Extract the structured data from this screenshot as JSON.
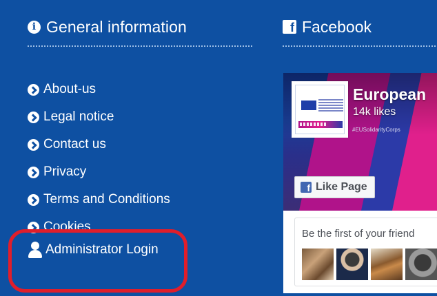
{
  "general": {
    "heading": "General information",
    "links": [
      {
        "label": "About-us"
      },
      {
        "label": "Legal notice"
      },
      {
        "label": "Contact us"
      },
      {
        "label": "Privacy"
      },
      {
        "label": "Terms and Conditions"
      },
      {
        "label": "Cookies"
      }
    ],
    "admin_login": "Administrator Login"
  },
  "facebook": {
    "heading": "Facebook",
    "page_name": "European",
    "likes": "14k likes",
    "handle": "#EUSolidarityCorps",
    "like_button": "Like Page",
    "friends_text": "Be the first of your friend"
  },
  "colors": {
    "background": "#0e50a2",
    "highlight": "#e01e2b",
    "facebook_blue": "#4267b2"
  },
  "icons": {
    "info": "info-circle-icon",
    "link_bullet": "chevron-circle-right-icon",
    "admin": "user-icon",
    "facebook": "facebook-square-icon"
  }
}
